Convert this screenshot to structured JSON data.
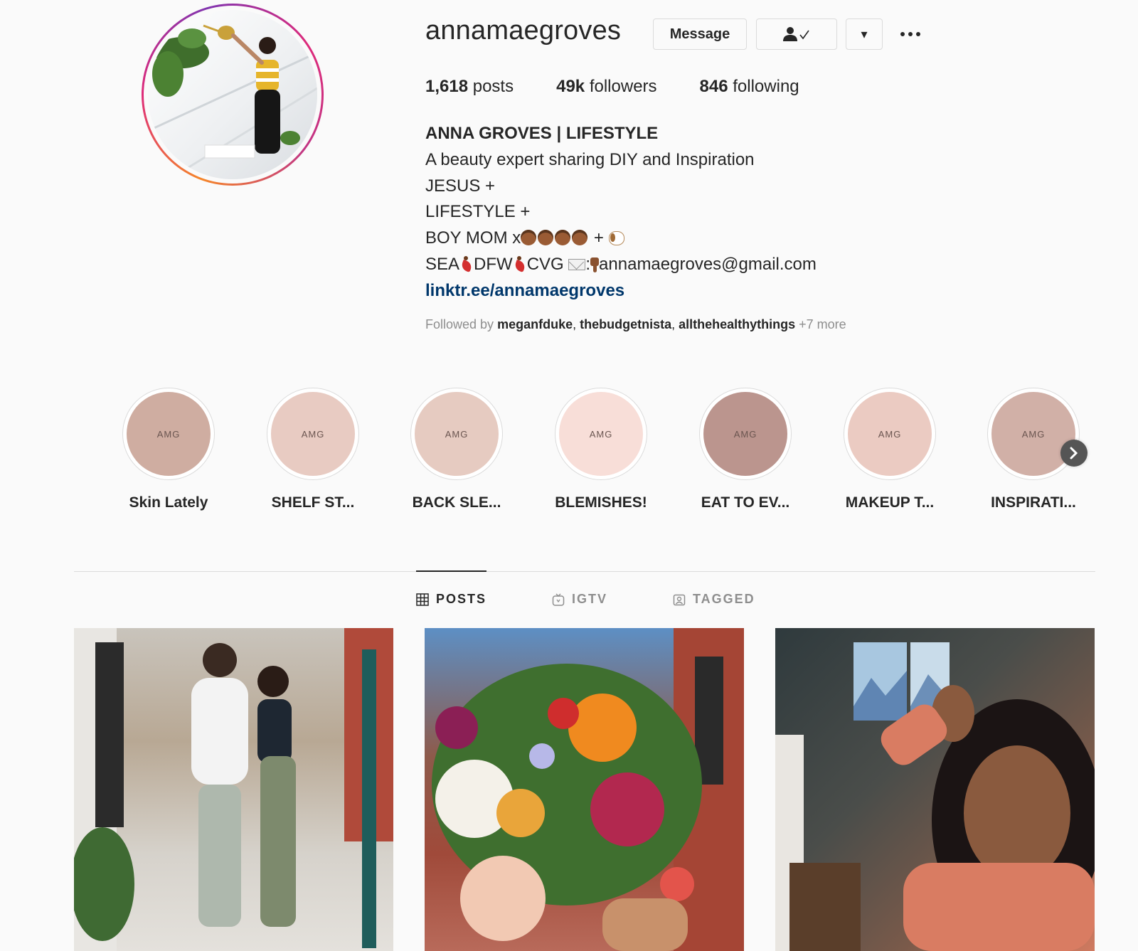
{
  "profile": {
    "username": "annamaegroves",
    "actions": {
      "message_label": "Message",
      "dropdown_glyph": "▾",
      "follow_icon": "person-check-icon"
    },
    "stats": {
      "posts_count": "1,618",
      "posts_label": "posts",
      "followers_count": "49k",
      "followers_label": "followers",
      "following_count": "846",
      "following_label": "following"
    },
    "bio": {
      "name": "ANNA GROVES | LIFESTYLE",
      "line1": "A beauty expert sharing DIY and Inspiration",
      "line2": "JESUS +",
      "line3": "LIFESTYLE +",
      "line4_text": "BOY MOM x",
      "line4_plus": " + ",
      "line5_a": "SEA",
      "line5_b": "DFW",
      "line5_c": "CVG ",
      "line5_colon": ":",
      "email": "annamaegroves@gmail.com",
      "link": "linktr.ee/annamaegroves"
    },
    "followed_by": {
      "prefix": "Followed by ",
      "user1": "meganfduke",
      "user2": "thebudgetnista",
      "user3": "allthehealthythings",
      "more": " +7 more",
      "sep": ", "
    }
  },
  "highlights": [
    {
      "label": "Skin Lately",
      "cover": "AMG",
      "color": "#cfada1"
    },
    {
      "label": "SHELF ST...",
      "cover": "AMG",
      "color": "#e8cbc2"
    },
    {
      "label": "BACK SLE...",
      "cover": "AMG",
      "color": "#e6cbc1"
    },
    {
      "label": "BLEMISHES!",
      "cover": "AMG",
      "color": "#f8ded8"
    },
    {
      "label": "EAT TO EV...",
      "cover": "AMG",
      "color": "#bb958e"
    },
    {
      "label": "MAKEUP T...",
      "cover": "AMG",
      "color": "#ebcbc2"
    },
    {
      "label": "INSPIRATI...",
      "cover": "AMG",
      "color": "#d1b0a7"
    }
  ],
  "tabs": [
    {
      "label": "POSTS",
      "active": true
    },
    {
      "label": "IGTV",
      "active": false
    },
    {
      "label": "TAGGED",
      "active": false
    }
  ],
  "colors": {
    "link": "#00376b",
    "border": "#dbdbdb",
    "muted": "#8e8e8e"
  }
}
